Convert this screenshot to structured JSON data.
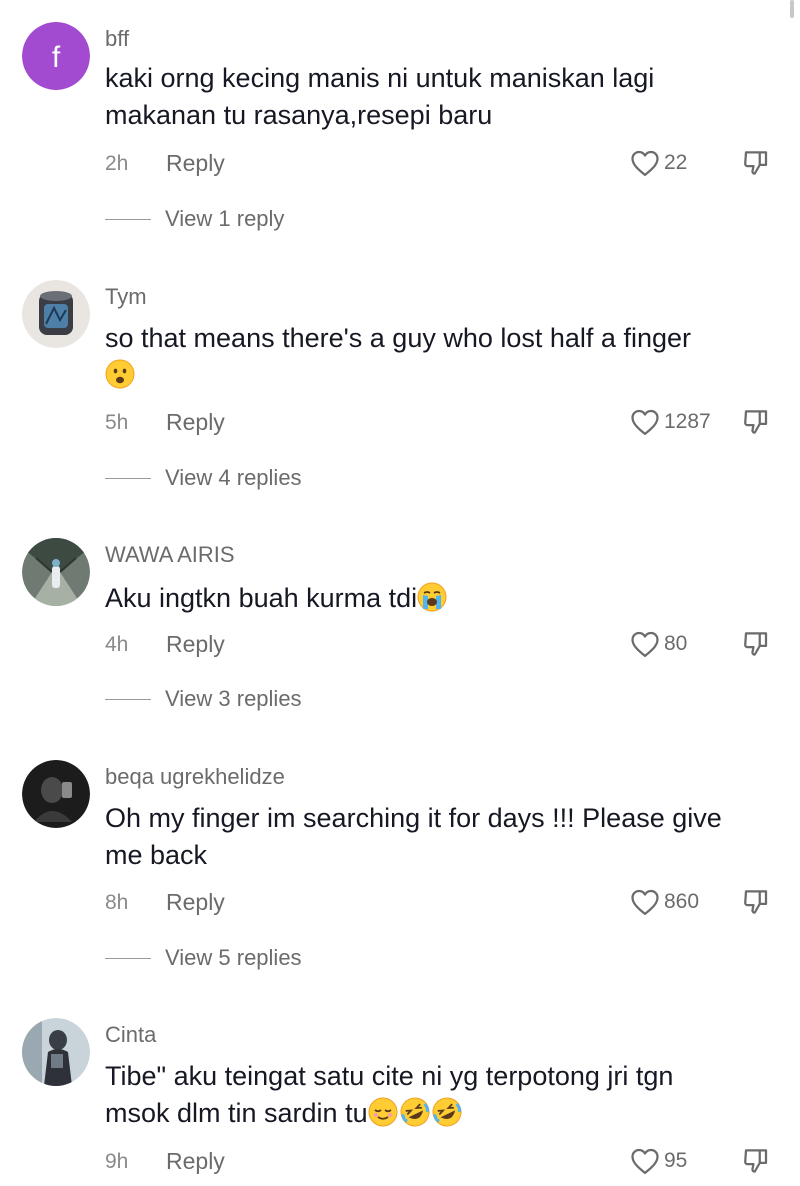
{
  "comments": [
    {
      "username": "bff",
      "avatar_letter": "f",
      "avatar_color": "#a24bd1",
      "text": "kaki orng kecing manis ni untuk maniskan lagi makanan tu rasanya,resepi baru",
      "time": "2h",
      "reply_label": "Reply",
      "likes": "22",
      "view_replies": "View 1 reply"
    },
    {
      "username": "Tym",
      "text": "so that means there's a guy who lost half a finger",
      "emoji": "frowning-face-emoji",
      "time": "5h",
      "reply_label": "Reply",
      "likes": "1287",
      "view_replies": "View 4 replies"
    },
    {
      "username": "WAWA AIRIS",
      "text": "Aku ingtkn buah kurma tdi",
      "emoji": "loudly-crying-face-emoji",
      "time": "4h",
      "reply_label": "Reply",
      "likes": "80",
      "view_replies": "View 3 replies"
    },
    {
      "username": "beqa ugrekhelidze",
      "text": "Oh my finger im searching it for days !!! Please give me back",
      "time": "8h",
      "reply_label": "Reply",
      "likes": "860",
      "view_replies": "View 5 replies"
    },
    {
      "username": "Cinta",
      "text_line1": "Tibe\" aku teingat satu cite ni yg terpotong jri tgn",
      "text_line2": "msok dlm tin sardin tu",
      "emojis": [
        "relieved-face-emoji",
        "rolling-laughing-emoji",
        "rolling-laughing-emoji"
      ],
      "time": "9h",
      "reply_label": "Reply",
      "likes": "95"
    }
  ],
  "icons": {
    "like": "heart-outline-icon",
    "dislike": "thumbs-down-icon"
  }
}
